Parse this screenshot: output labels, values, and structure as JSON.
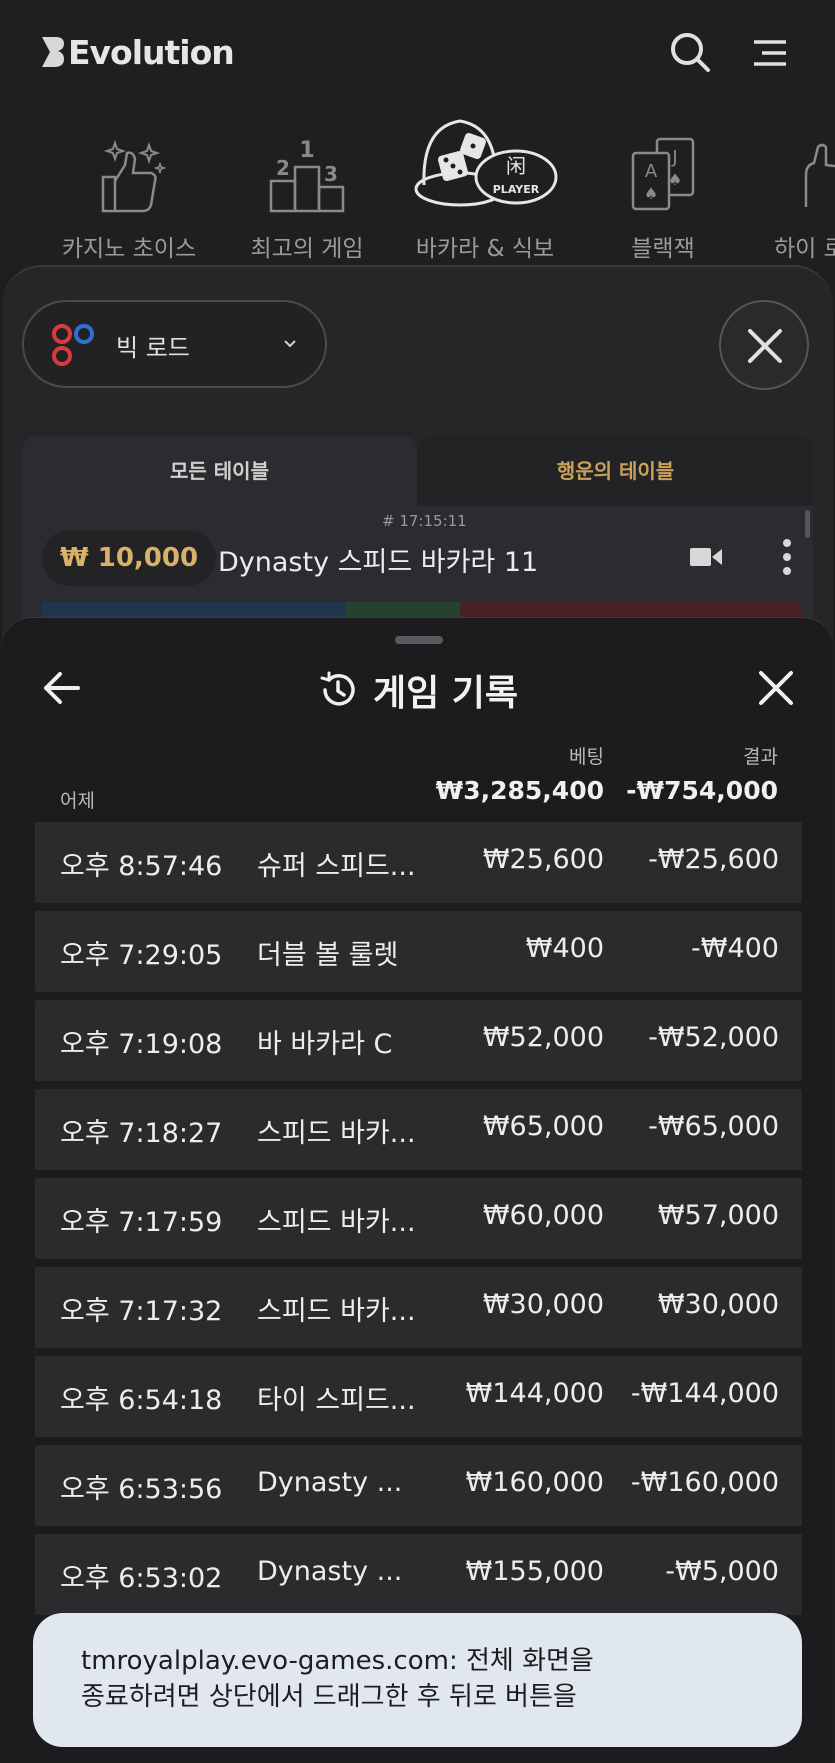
{
  "brand": {
    "name": "Evolution"
  },
  "categories": [
    {
      "label": "카지노 초이스",
      "icon": "thumbs-up-sparkle-icon",
      "active": false
    },
    {
      "label": "최고의 게임",
      "icon": "podium-icon",
      "active": false
    },
    {
      "label": "바카라 & 식보",
      "icon": "dice-player-chip-icon",
      "active": true
    },
    {
      "label": "블랙잭",
      "icon": "playing-cards-icon",
      "active": false
    },
    {
      "label": "하이 로",
      "icon": "hand-icon",
      "active": false
    }
  ],
  "filter": {
    "road_label": "빅 로드",
    "tabs": {
      "all": "모든 테이블",
      "lucky": "행운의 테이블"
    },
    "table": {
      "time": "# 17:15:11",
      "bet": "₩ 10,000",
      "name": "Dynasty 스피드 바카라 11"
    }
  },
  "history": {
    "title": "게임 기록",
    "col_bet": "베팅",
    "col_result": "결과",
    "day": "어제",
    "total_bet": "₩3,285,400",
    "total_result": "-₩754,000",
    "rows": [
      {
        "time": "오후 8:57:46",
        "game": "슈퍼 스피드...",
        "bet": "₩25,600",
        "result": "-₩25,600"
      },
      {
        "time": "오후 7:29:05",
        "game": "더블 볼 룰렛",
        "bet": "₩400",
        "result": "-₩400"
      },
      {
        "time": "오후 7:19:08",
        "game": "바 바카라 C",
        "bet": "₩52,000",
        "result": "-₩52,000"
      },
      {
        "time": "오후 7:18:27",
        "game": "스피드 바카...",
        "bet": "₩65,000",
        "result": "-₩65,000"
      },
      {
        "time": "오후 7:17:59",
        "game": "스피드 바카...",
        "bet": "₩60,000",
        "result": "₩57,000"
      },
      {
        "time": "오후 7:17:32",
        "game": "스피드 바카...",
        "bet": "₩30,000",
        "result": "₩30,000"
      },
      {
        "time": "오후 6:54:18",
        "game": "타이 스피드...",
        "bet": "₩144,000",
        "result": "-₩144,000"
      },
      {
        "time": "오후 6:53:56",
        "game": "Dynasty ...",
        "bet": "₩160,000",
        "result": "-₩160,000"
      },
      {
        "time": "오후 6:53:02",
        "game": "Dynasty ...",
        "bet": "₩155,000",
        "result": "-₩5,000"
      }
    ]
  },
  "toast": {
    "line1": "tmroyalplay.evo-games.com: 전체 화면을",
    "line2": "종료하려면 상단에서 드래그한 후 뒤로 버튼을"
  }
}
